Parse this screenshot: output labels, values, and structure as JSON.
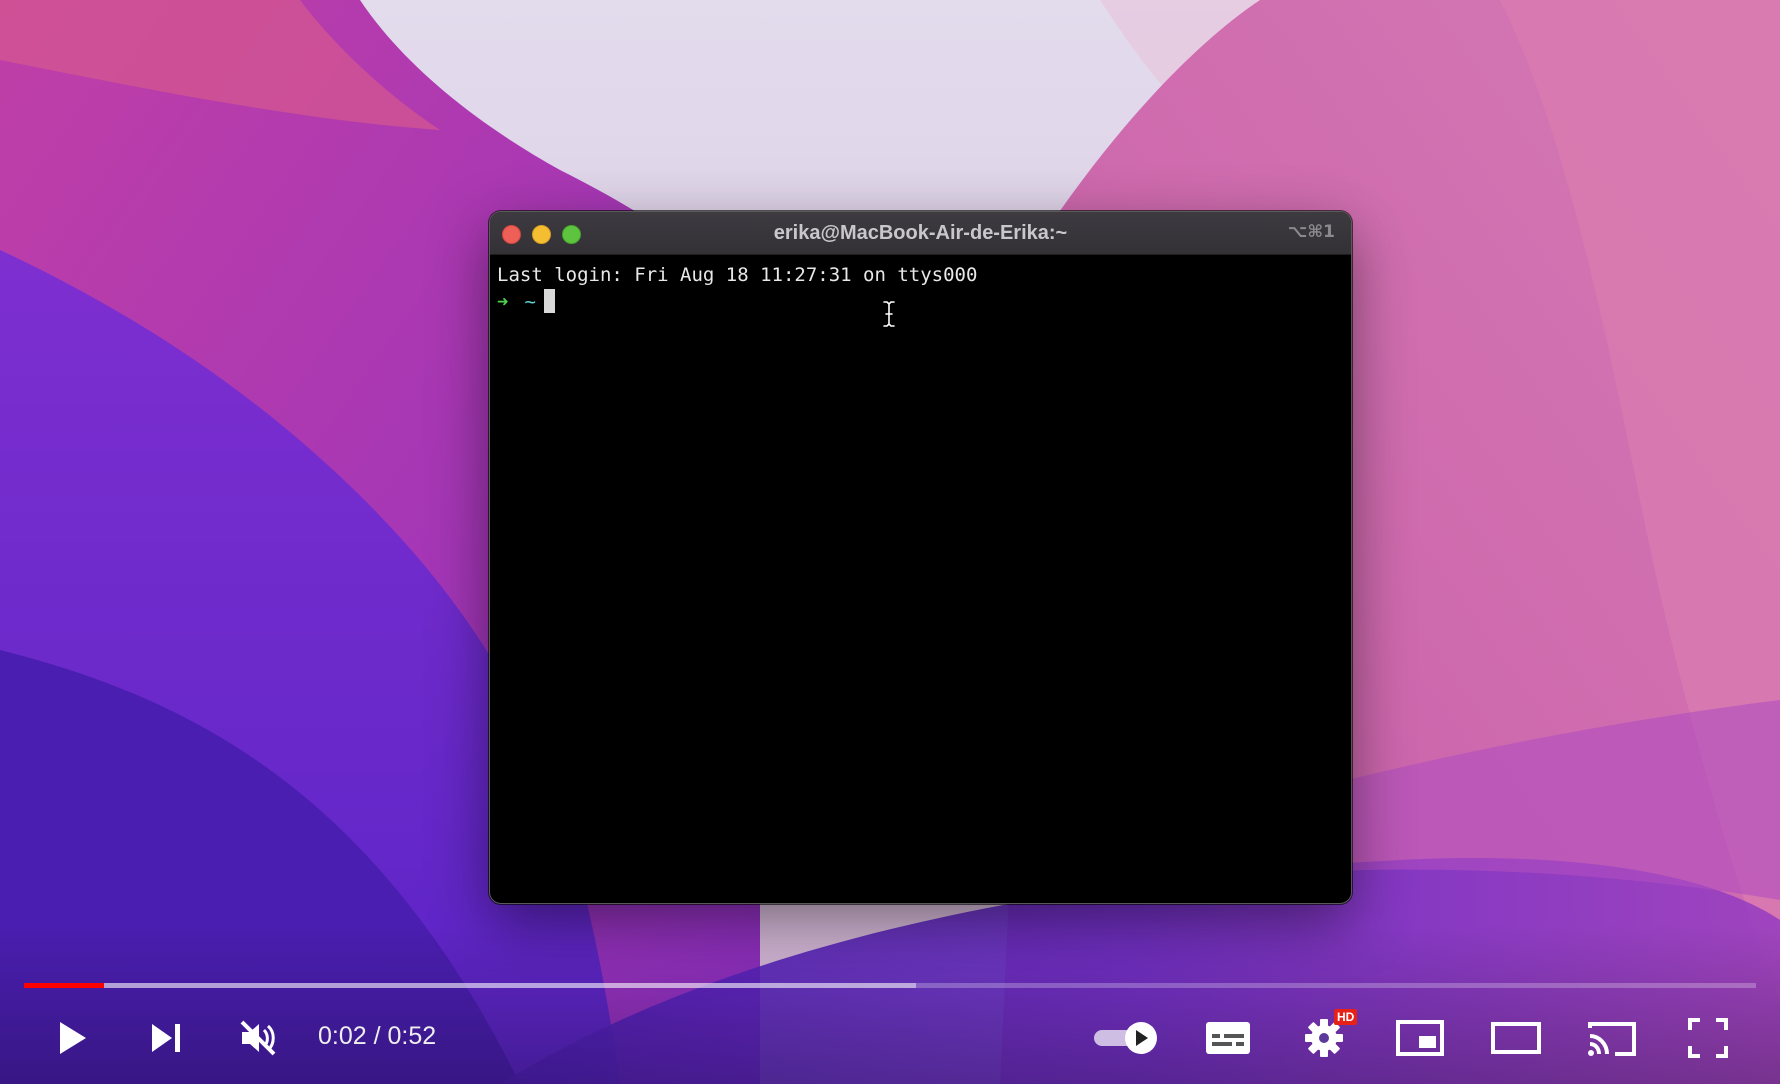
{
  "terminal": {
    "title": "erika@MacBook-Air-de-Erika:~",
    "shortcut": "⌥⌘1",
    "last_login": "Last login: Fri Aug 18 11:27:31 on ttys000",
    "prompt_arrow": "➜",
    "prompt_dir": "~"
  },
  "player": {
    "time_display": "0:02 / 0:52",
    "progress_played": 0.046,
    "progress_buffered": 0.515,
    "hd_badge": "HD",
    "muted": true,
    "autoplay_on": true
  },
  "icons": {
    "play": "play-icon",
    "next": "next-icon",
    "mute": "volume-muted-icon",
    "autoplay": "autoplay-toggle-icon",
    "subtitles": "subtitles-icon",
    "settings": "gear-icon",
    "miniplayer": "miniplayer-icon",
    "theater": "theater-mode-icon",
    "cast": "cast-icon",
    "fullscreen": "fullscreen-icon"
  },
  "colors": {
    "progress_played": "#ff0000",
    "prompt_arrow": "#4fd14f",
    "prompt_dir": "#5fd7d7",
    "close": "#ed5f57",
    "minimize": "#f5be32",
    "maximize": "#5ec43f"
  }
}
